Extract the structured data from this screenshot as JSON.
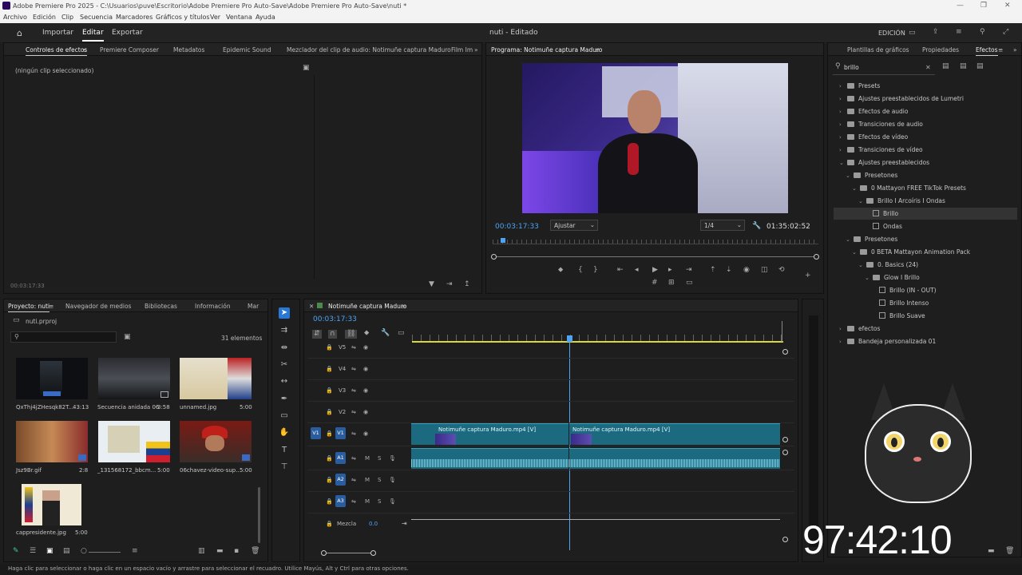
{
  "window": {
    "title": "Adobe Premiere Pro 2025 - C:\\Usuarios\\puve\\Escritorio\\Adobe Premiere Pro Auto-Save\\Adobe Premiere Pro Auto-Save\\nuti *"
  },
  "menu": [
    "Archivo",
    "Edición",
    "Clip",
    "Secuencia",
    "Marcadores",
    "Gráficos y títulos",
    "Ver",
    "Ventana",
    "Ayuda"
  ],
  "workspace": {
    "tabs": [
      "Importar",
      "Editar",
      "Exportar"
    ],
    "center_title": "nuti - Editado",
    "mode": "EDICIÓN"
  },
  "effect_controls": {
    "tabs": [
      "Controles de efectos",
      "Premiere Composer",
      "Metadatos",
      "Epidemic Sound",
      "Mezclador del clip de audio: Notimuñe captura Maduro",
      "Film Im"
    ],
    "empty_message": "(ningún clip seleccionado)",
    "timecode": "00:03:17:33"
  },
  "program": {
    "title": "Programa: Notimuñe captura Maduro",
    "timecode": "00:03:17:33",
    "fit": "Ajustar",
    "resolution": "1/4",
    "duration": "01:35:02:52"
  },
  "effects": {
    "tabs": [
      "Plantillas de gráficos",
      "Propiedades",
      "Efectos"
    ],
    "search_value": "brillo",
    "tree": [
      {
        "label": "Presets",
        "depth": 0,
        "type": "folder",
        "expanded": false
      },
      {
        "label": "Ajustes preestablecidos de Lumetri",
        "depth": 0,
        "type": "folder",
        "expanded": false
      },
      {
        "label": "Efectos de audio",
        "depth": 0,
        "type": "folder",
        "expanded": false
      },
      {
        "label": "Transiciones de audio",
        "depth": 0,
        "type": "folder",
        "expanded": false
      },
      {
        "label": "Efectos de vídeo",
        "depth": 0,
        "type": "folder",
        "expanded": false
      },
      {
        "label": "Transiciones de vídeo",
        "depth": 0,
        "type": "folder",
        "expanded": false
      },
      {
        "label": "Ajustes preestablecidos",
        "depth": 0,
        "type": "folder",
        "expanded": true
      },
      {
        "label": "Presetones",
        "depth": 1,
        "type": "folder",
        "expanded": true
      },
      {
        "label": "0 Mattayon FREE TikTok Presets",
        "depth": 2,
        "type": "folder",
        "expanded": true
      },
      {
        "label": "Brillo I Arcoíris I Ondas",
        "depth": 3,
        "type": "folder",
        "expanded": true
      },
      {
        "label": "Brillo",
        "depth": 4,
        "type": "preset",
        "selected": true
      },
      {
        "label": "Ondas",
        "depth": 4,
        "type": "preset"
      },
      {
        "label": "Presetones",
        "depth": 1,
        "type": "folder",
        "expanded": true
      },
      {
        "label": "0 BETA Mattayon Animation Pack",
        "depth": 2,
        "type": "folder",
        "expanded": true
      },
      {
        "label": "0. Basics (24)",
        "depth": 3,
        "type": "folder",
        "expanded": true
      },
      {
        "label": "Glow I Brillo",
        "depth": 4,
        "type": "folder",
        "expanded": true
      },
      {
        "label": "Brillo (IN - OUT)",
        "depth": 5,
        "type": "preset"
      },
      {
        "label": "Brillo Intenso",
        "depth": 5,
        "type": "preset"
      },
      {
        "label": "Brillo Suave",
        "depth": 5,
        "type": "preset"
      },
      {
        "label": "efectos",
        "depth": 0,
        "type": "folder",
        "expanded": false
      },
      {
        "label": "Bandeja personalizada 01",
        "depth": 0,
        "type": "folder",
        "expanded": false
      }
    ]
  },
  "project": {
    "tabs": [
      "Proyecto: nuti",
      "Navegador de medios",
      "Bibliotecas",
      "Información",
      "Mar"
    ],
    "file": "nuti.prproj",
    "count": "31 elementos",
    "items": [
      {
        "name": "QxThj4jZHesqk82T...",
        "dur": "43:13"
      },
      {
        "name": "Secuencia anidada 06",
        "dur": "3:58"
      },
      {
        "name": "unnamed.jpg",
        "dur": "5:00"
      },
      {
        "name": "Jsz9Br.gif",
        "dur": "2:8"
      },
      {
        "name": "_131568172_bbcm...",
        "dur": "5:00"
      },
      {
        "name": "06chavez-video-sup...",
        "dur": "5:00"
      },
      {
        "name": "cappresidente.jpg",
        "dur": "5:00"
      }
    ]
  },
  "timeline": {
    "title": "Notimuñe captura Maduro",
    "timecode": "00:03:17:33",
    "video_tracks": [
      "V5",
      "V4",
      "V3",
      "V2",
      "V1"
    ],
    "audio_tracks": [
      "A1",
      "A2",
      "A3"
    ],
    "source_label": "V1",
    "mix_label": "Mezcla",
    "mix_value": "0.0",
    "clips": [
      "Notimuñe captura Maduro.mp4 [V]",
      "Notimuñe captura Maduro.mp4 [V]"
    ],
    "m": "M",
    "s": "S"
  },
  "overlay": {
    "big_timer": "97:42:10"
  },
  "status": "Haga clic para seleccionar o haga clic en un espacio vacío y arrastre para seleccionar el recuadro. Utilice Mayús, Alt y Ctrl para otras opciones.",
  "colors": {
    "accent": "#4ea3f5",
    "track_blue": "#2a5d9f",
    "clip": "#1b6a80",
    "yellow": "#d8d83a"
  }
}
